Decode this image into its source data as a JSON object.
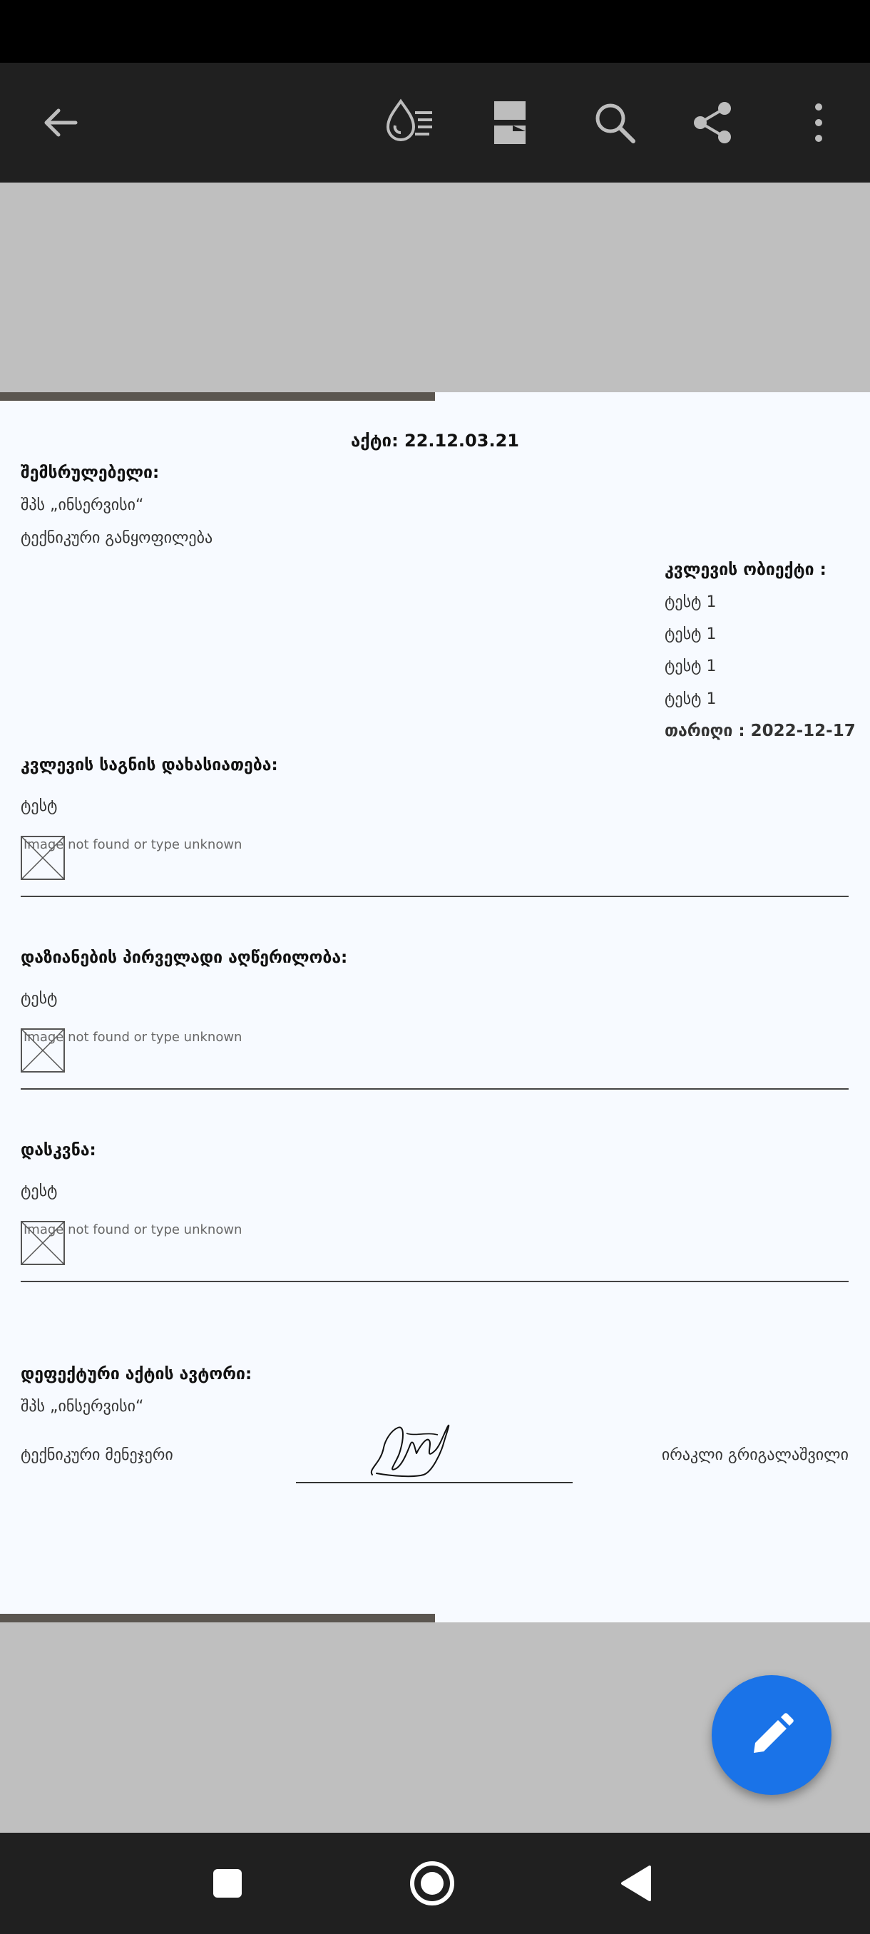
{
  "toolbar": {
    "back_icon": "arrow-left-icon",
    "icons": [
      "reading-mode-icon",
      "page-layout-icon",
      "search-icon",
      "share-icon",
      "more-vert-icon"
    ]
  },
  "document": {
    "act_title": "აქტი: 22.12.03.21",
    "performer_label": "შემსრულებელი:",
    "company": "შპს „ინსერვისი“",
    "department": "ტექნიკური განყოფილება",
    "object_label": "კვლევის ობიექტი :",
    "object_items": [
      "ტესტ 1",
      "ტესტ 1",
      "ტესტ 1",
      "ტესტ 1"
    ],
    "date_line": "თარიღი : 2022-12-17",
    "sections": [
      {
        "title": "კვლევის საგნის დახასიათება:",
        "text": "ტესტ",
        "image_alt": "Image not found or type unknown"
      },
      {
        "title": "დაზიანების პირველადი აღწერილობა:",
        "text": "ტესტ",
        "image_alt": "Image not found or type unknown"
      },
      {
        "title": "დასკვნა:",
        "text": "ტესტ",
        "image_alt": "Image not found or type unknown"
      }
    ],
    "author_label": "დეფექტური აქტის ავტორი:",
    "author_company": "შპს „ინსერვისი“",
    "author_position": "ტექნიკური მენეჯერი",
    "author_name": "ირაკლი გრიგალაშვილი"
  },
  "fab": {
    "icon": "edit-pencil-icon"
  },
  "navbar": {
    "icons": [
      "recents-square-icon",
      "home-circle-icon",
      "back-triangle-icon"
    ]
  },
  "colors": {
    "toolbar": "#202020",
    "fab": "#1a73e8",
    "page": "#f7faff",
    "backdrop": "#bfbfbf"
  }
}
